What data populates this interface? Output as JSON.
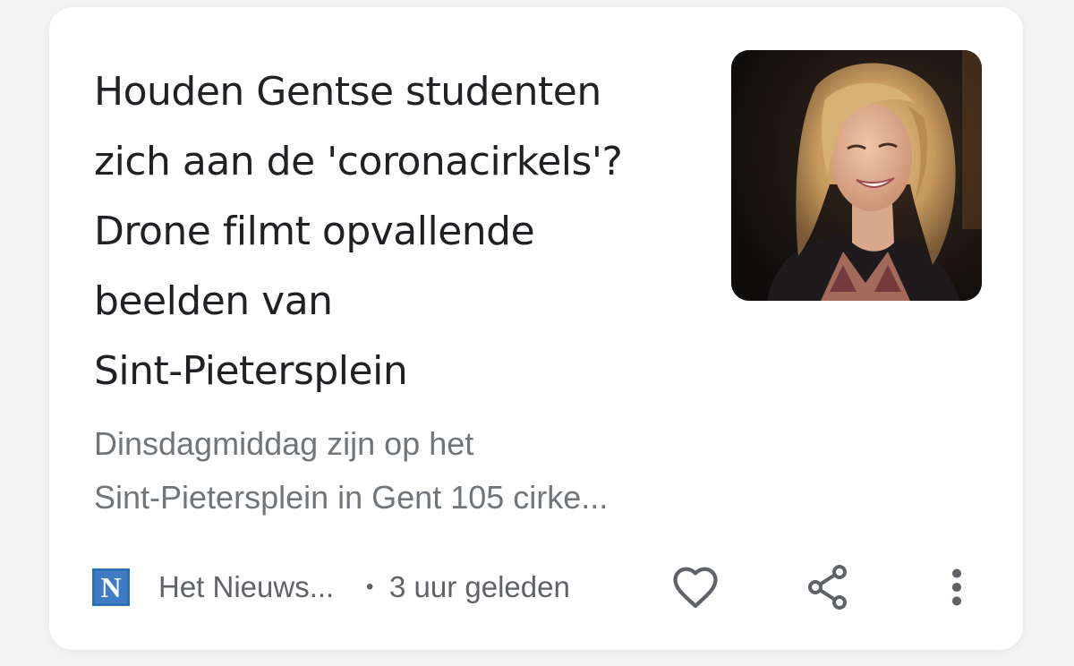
{
  "article": {
    "headline_lines": [
      "Houden Gentse studenten",
      "zich aan de 'coronacirkels'?",
      "Drone filmt opvallende",
      "beelden van",
      "Sint-Pietersplein"
    ],
    "snippet_lines": [
      "Dinsdagmiddag zijn op het",
      "Sint-Pietersplein in Gent 105 cirke..."
    ],
    "publisher": {
      "logo_letter": "N",
      "logo_color": "#2f6fb3",
      "name": "Het Nieuws..."
    },
    "separator": "•",
    "time_ago": "3 uur geleden"
  },
  "actions": {
    "like_icon": "heart-outline-icon",
    "share_icon": "share-icon",
    "more_icon": "more-vert-icon"
  },
  "colors": {
    "headline": "#202124",
    "secondary_text": "#70757a",
    "icon": "#5f6368",
    "background": "#f3f3f4",
    "card": "#ffffff"
  }
}
